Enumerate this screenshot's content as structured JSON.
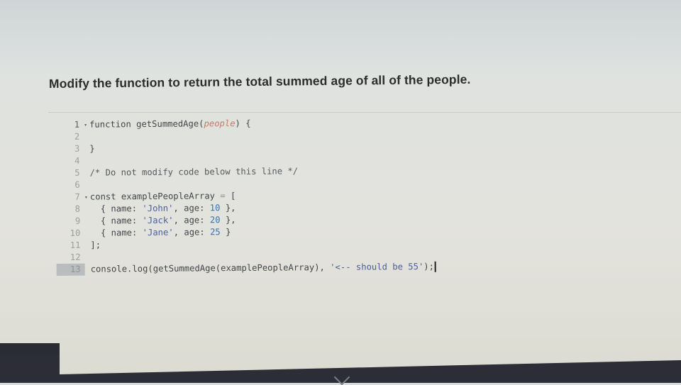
{
  "prompt": "Modify the function to return the total summed age of all of the people.",
  "editor": {
    "lines": [
      {
        "n": "1",
        "fold": true
      },
      {
        "n": "2"
      },
      {
        "n": "3"
      },
      {
        "n": "4"
      },
      {
        "n": "5"
      },
      {
        "n": "6"
      },
      {
        "n": "7",
        "fold": true
      },
      {
        "n": "8"
      },
      {
        "n": "9"
      },
      {
        "n": "10"
      },
      {
        "n": "11"
      },
      {
        "n": "12"
      },
      {
        "n": "13",
        "active": true
      }
    ],
    "code": {
      "l1_kw": "function",
      "l1_name": " getSummedAge(",
      "l1_param": "people",
      "l1_end": ") {",
      "l3": "}",
      "l5": "/* Do not modify code below this line */",
      "l7_kw": "const",
      "l7_rest": " examplePeopleArray ",
      "l7_eq": "=",
      "l7_open": " [",
      "people": [
        {
          "name": "'John'",
          "age": "10",
          "tail": " },"
        },
        {
          "name": "'Jack'",
          "age": "20",
          "tail": " },"
        },
        {
          "name": "'Jane'",
          "age": "25",
          "tail": " }"
        }
      ],
      "name_key": "  { name: ",
      "age_key": ", age: ",
      "l11": "];",
      "l13_call": "console.log(getSummedAge(examplePeopleArray), ",
      "l13_str": "'<-- should be 55'",
      "l13_end": ");"
    }
  },
  "fold_icon": "▾"
}
